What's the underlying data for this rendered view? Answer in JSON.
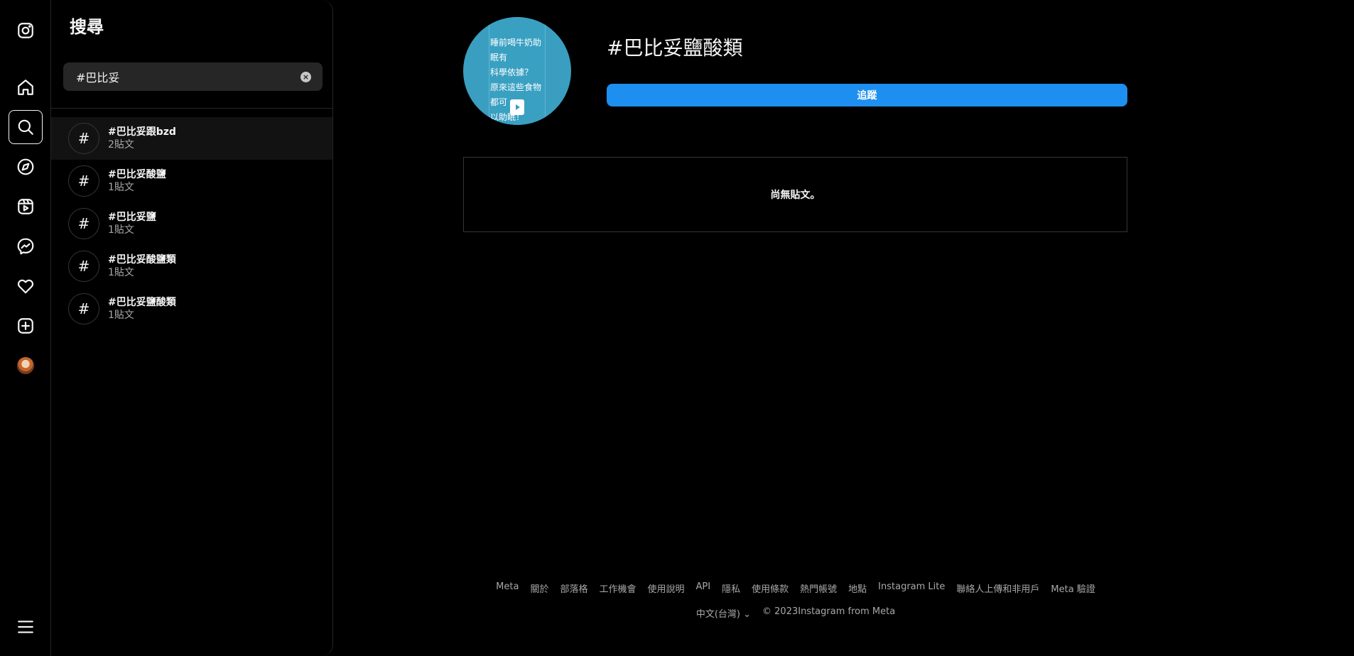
{
  "rail": {
    "icons": [
      "instagram-logo-icon",
      "home-icon",
      "search-icon",
      "explore-icon",
      "reels-icon",
      "messenger-icon",
      "heart-icon",
      "create-icon",
      "profile-avatar",
      "menu-icon"
    ]
  },
  "search_panel": {
    "title": "搜尋",
    "query": "#巴比妥",
    "results": [
      {
        "name": "#巴比妥跟bzd",
        "count": "2貼文"
      },
      {
        "name": "#巴比妥酸鹽",
        "count": "1貼文"
      },
      {
        "name": "#巴比妥鹽",
        "count": "1貼文"
      },
      {
        "name": "#巴比妥酸鹽類",
        "count": "1貼文"
      },
      {
        "name": "#巴比妥鹽酸類",
        "count": "1貼文"
      }
    ]
  },
  "main": {
    "tag_image_text": [
      "睡前喝牛奶助眠有",
      "科學依據？",
      "原來這些食物都可",
      "以助眠！"
    ],
    "tag_title": "#巴比妥鹽酸類",
    "follow_label": "追蹤",
    "empty_text": "尚無貼文。"
  },
  "footer": {
    "links": [
      "Meta",
      "關於",
      "部落格",
      "工作機會",
      "使用說明",
      "API",
      "隱私",
      "使用條款",
      "熱門帳號",
      "地點",
      "Instagram Lite",
      "聯絡人上傳和非用戶",
      "Meta 驗證"
    ],
    "language": "中文(台灣)",
    "copyright": "© 2023Instagram from Meta"
  },
  "colors": {
    "accent": "#1d8ff0",
    "background": "#000000",
    "tag_image": "#3a9ec0"
  }
}
